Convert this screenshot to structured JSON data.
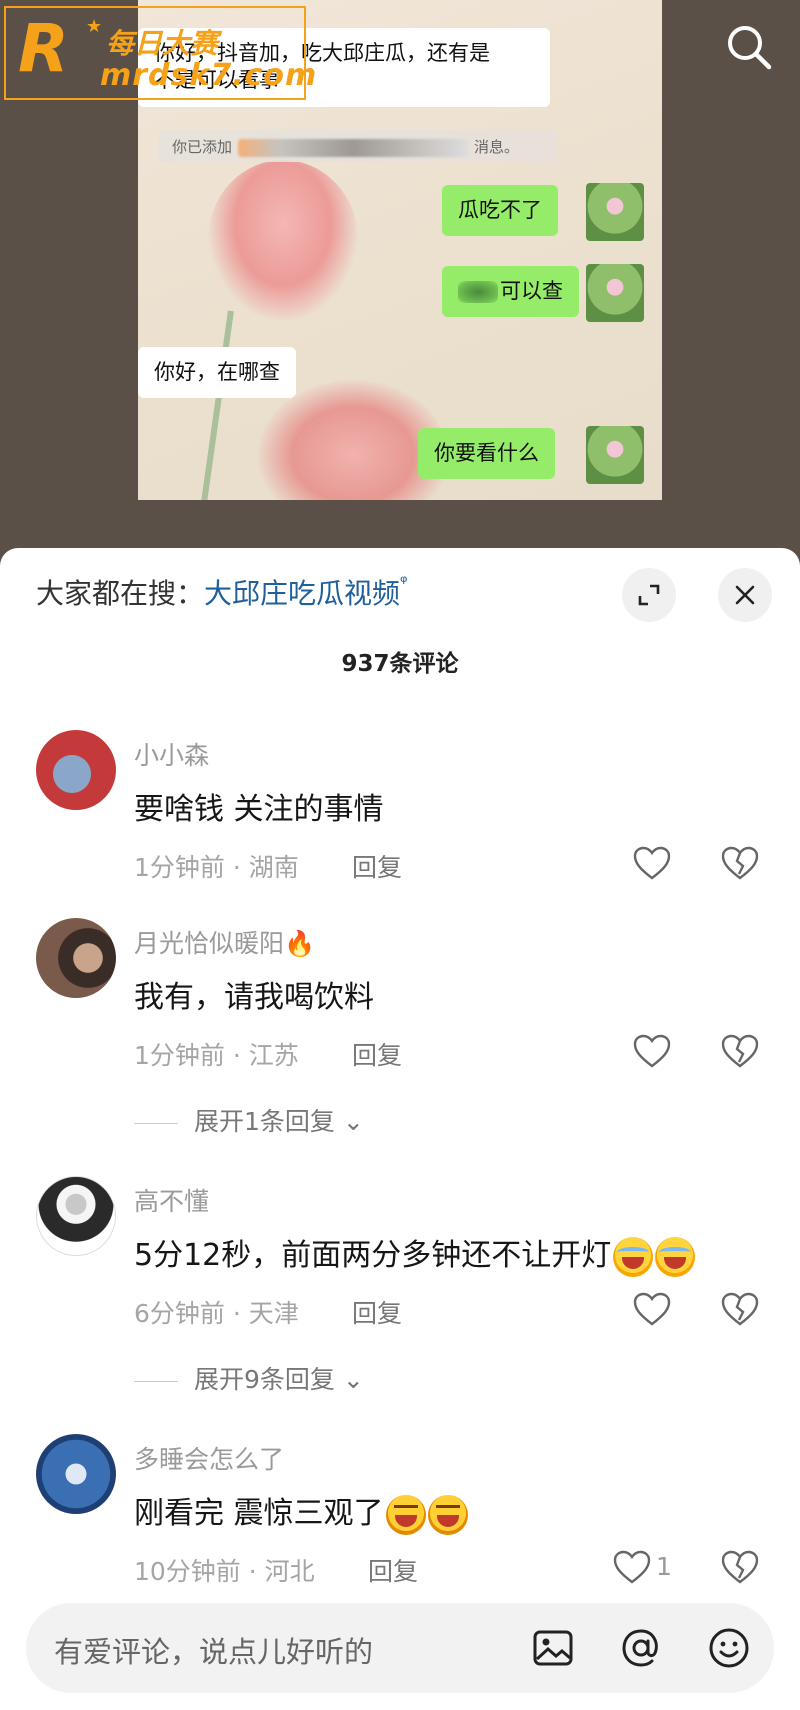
{
  "watermark": {
    "brand_cn": "每日大赛",
    "url": "mrdsk7.com",
    "letter": "R"
  },
  "video_chat": {
    "msg_incoming_1": [
      "你好，抖音加，吃大邱庄瓜，还有是",
      "不是可以看事"
    ],
    "system_prefix": "你已添加",
    "system_suffix": "消息。",
    "msg_out_1": "瓜吃不了",
    "msg_out_2": "可以查",
    "msg_incoming_2": "你好，在哪查",
    "msg_out_3": "你要看什么"
  },
  "search_hint": {
    "prefix": "大家都在搜：",
    "query": "大邱庄吃瓜视频",
    "search_glyph": "ᵠ"
  },
  "comment_count": "937条评论",
  "comments": [
    {
      "name": "小小森",
      "text": "要啥钱  关注的事情",
      "meta": "1分钟前 · 湖南",
      "reply": "回复",
      "likes": ""
    },
    {
      "name": "月光恰似暖阳",
      "name_emoji": "🔥",
      "text": "我有，请我喝饮料",
      "meta": "1分钟前 · 江苏",
      "reply": "回复",
      "likes": "",
      "expand": "展开1条回复"
    },
    {
      "name": "高不懂",
      "text": "5分12秒，前面两分多钟还不让开灯",
      "meta": "6分钟前 · 天津",
      "reply": "回复",
      "likes": "",
      "expand": "展开9条回复"
    },
    {
      "name": "多睡会怎么了",
      "text": "刚看完 震惊三观了",
      "meta": "10分钟前 · 河北",
      "reply": "回复",
      "likes": "1"
    }
  ],
  "input": {
    "placeholder": "有爱评论，说点儿好听的"
  },
  "icons": {
    "search": "search-icon",
    "expand": "expand-icon",
    "close": "close-icon",
    "like": "heart-icon",
    "dislike": "broken-heart-icon",
    "image": "image-icon",
    "at": "at-icon",
    "emoji": "emoji-icon"
  },
  "colors": {
    "link": "#1f5f9c",
    "wechat_green": "#95ec69",
    "watermark_orange": "#f6a11a"
  }
}
